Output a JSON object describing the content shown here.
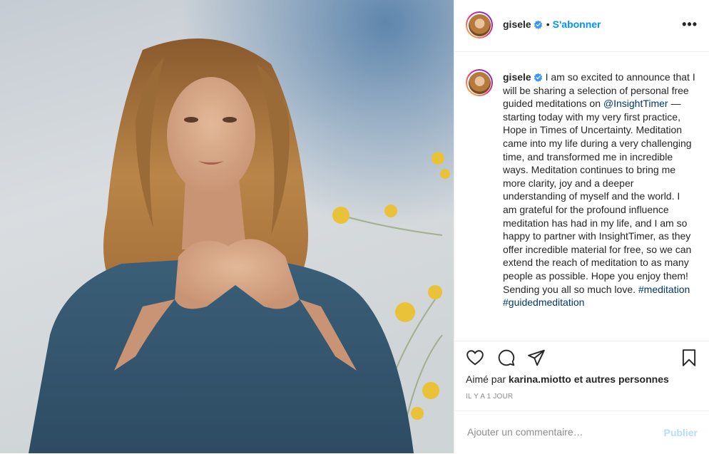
{
  "post": {
    "username": "gisele",
    "separator": "•",
    "follow_label": "S'abonner",
    "more_label": "•••",
    "caption_username": "gisele",
    "caption_part1": " I am so excited to announce that I will be sharing a selection of personal free guided meditations on ",
    "mention": "@InsightTimer",
    "caption_part2": " —starting today with my very first practice, Hope in Times of Uncertainty. Meditation came into my life during a very challenging time, and transformed me in incredible ways. Meditation continues to bring me more clarity, joy and a deeper understanding of myself and the world. I am grateful for the profound influence meditation has had in my life, and I am so happy to partner with InsightTimer, as they offer incredible material for free, so we can extend the reach of meditation to as many people as possible. Hope you enjoy them! Sending you all so much love. ",
    "hashtag1": "#meditation",
    "hashtag2": "#guidedmeditation",
    "likes_prefix": "Aimé par",
    "likes_user": "karina.miotto",
    "likes_suffix": "et autres personnes",
    "timestamp": "IL Y A 1 JOUR",
    "comment_placeholder": "Ajouter un commentaire…",
    "publish_label": "Publier"
  },
  "icons": {
    "like": "heart-icon",
    "comment": "comment-icon",
    "share": "share-icon",
    "save": "bookmark-icon",
    "verified": "verified-badge-icon"
  },
  "colors": {
    "accent": "#0095f6",
    "publish_disabled": "#b2dffc",
    "muted": "#8e8e8e",
    "link": "#00376b"
  }
}
